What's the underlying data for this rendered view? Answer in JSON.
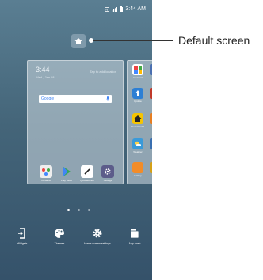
{
  "status_bar": {
    "time": "3:44 AM"
  },
  "home_screen_card": {
    "time": "3:44",
    "date": "Wed., Jan 18",
    "weather": "Tap to add location",
    "search_brand": "Google",
    "dock_apps": [
      {
        "label": "Contacts",
        "icon": "contacts-icon",
        "color": "#e8e8e8"
      },
      {
        "label": "Play Store",
        "icon": "play-store-icon",
        "color": "#ffffff"
      },
      {
        "label": "QuickMemo+",
        "icon": "quickmemo-icon",
        "color": "#ffffff"
      },
      {
        "label": "Settings",
        "icon": "settings-icon",
        "color": "#5c5c8a"
      }
    ]
  },
  "side_page": {
    "apps": [
      {
        "label": "Assistant",
        "icon": "assistant-icon",
        "color": "#ffffff"
      },
      {
        "label": "Update",
        "icon": "update-icon",
        "color": "#2d7fd4"
      },
      {
        "label": "SmartWorld",
        "icon": "smartworld-icon",
        "color": "#f5c400"
      },
      {
        "label": "Weather",
        "icon": "weather-icon",
        "color": "#3a9ad9"
      },
      {
        "label": "Gallery",
        "icon": "gallery-icon",
        "color": "#f28c28"
      }
    ]
  },
  "page_indicator": {
    "count": 3,
    "active_index": 0
  },
  "bottom_menu": [
    {
      "label": "Widgets",
      "icon": "widgets-icon"
    },
    {
      "label": "Themes",
      "icon": "themes-palette-icon"
    },
    {
      "label": "Home screen settings",
      "icon": "gear-icon"
    },
    {
      "label": "App trash",
      "icon": "app-trash-icon"
    }
  ],
  "callout": {
    "label": "Default screen"
  }
}
